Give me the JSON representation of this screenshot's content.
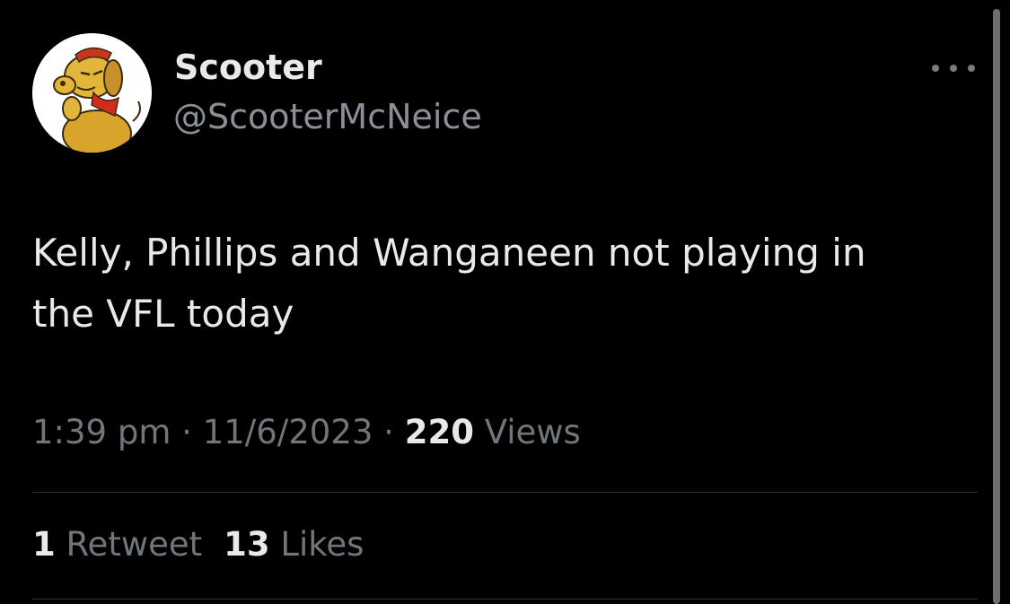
{
  "tweet": {
    "display_name": "Scooter",
    "handle": "@ScooterMcNeice",
    "text": "Kelly, Phillips and Wanganeen not playing in\nthe VFL today",
    "time": "1:39 pm",
    "separator": "·",
    "date": "11/6/2023",
    "views_count": "220",
    "views_label": "Views",
    "retweets_count": "1",
    "retweets_label": "Retweet",
    "likes_count": "13",
    "likes_label": "Likes"
  },
  "icons": {
    "avatar": "cartoon-dog-avatar",
    "more": "more-options-icon"
  },
  "colors": {
    "background": "#000000",
    "primary_text": "#e7e9ea",
    "secondary_text": "#71767b",
    "divider": "#2f3336"
  }
}
